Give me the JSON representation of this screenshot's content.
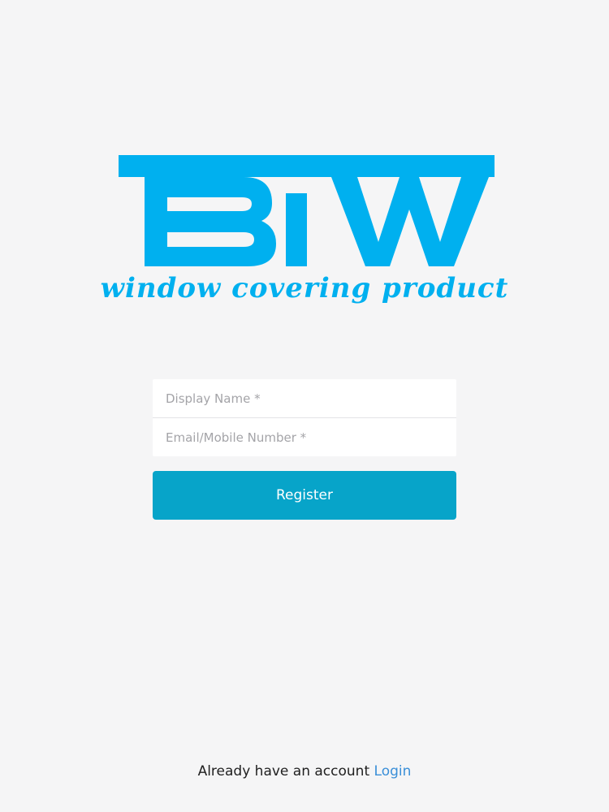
{
  "logo": {
    "brand": "BIW",
    "tagline": "window covering product",
    "color": "#00b0ef"
  },
  "form": {
    "display_name_placeholder": "Display Name *",
    "email_placeholder": "Email/Mobile Number *",
    "register_label": "Register",
    "button_color": "#07a4c9"
  },
  "footer": {
    "prompt": "Already have an account",
    "login_label": "Login",
    "link_color": "#3a8fd8"
  }
}
